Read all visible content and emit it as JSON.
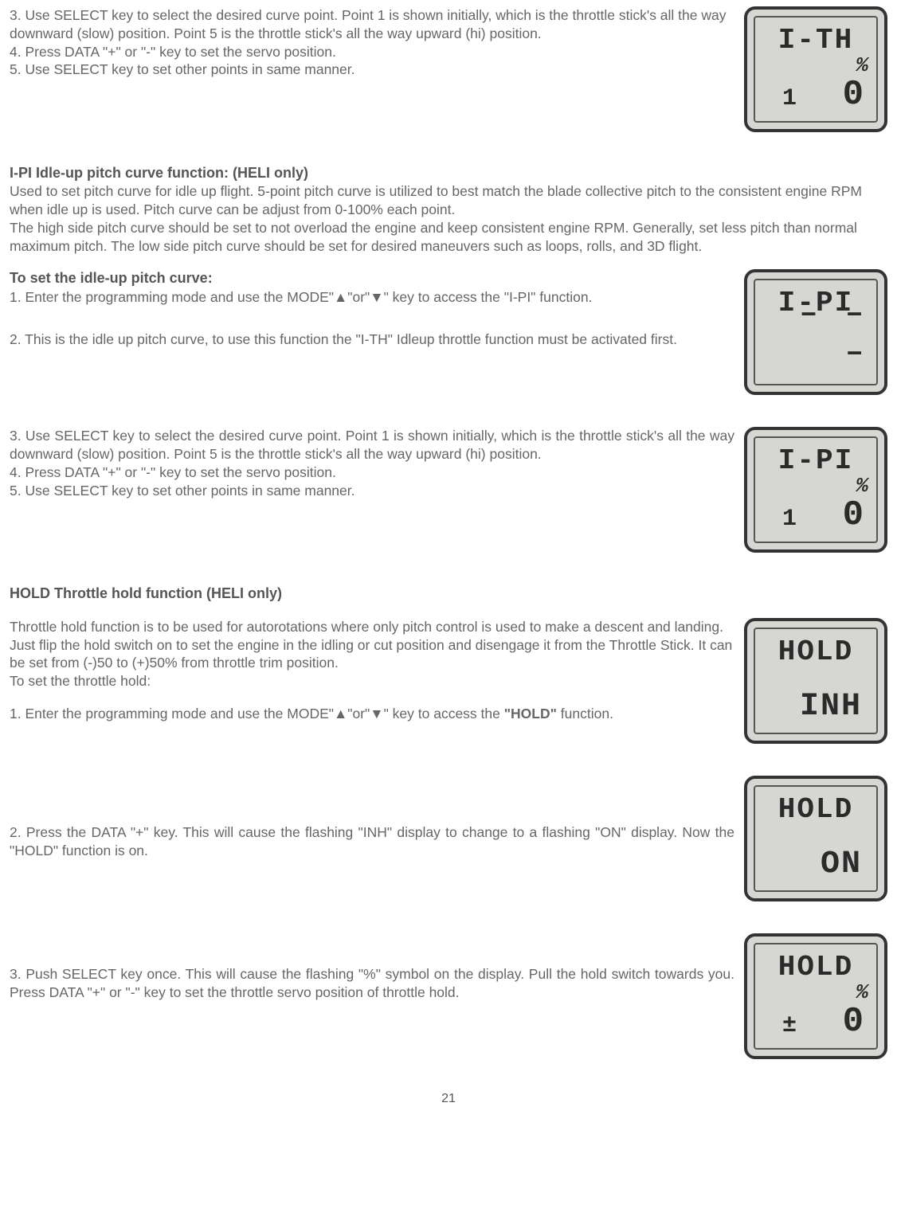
{
  "section_a": {
    "p3": "3. Use SELECT key to select the desired curve point. Point 1 is shown initially, which is the throttle stick's all the way downward (slow) position. Point 5 is the throttle stick's all the way upward (hi) position.",
    "p4": "4. Press DATA \"+\" or \"-\" key to set the servo position.",
    "p5": "5. Use SELECT key to set other points in same manner."
  },
  "lcd1": {
    "top": "I-TH",
    "pct": "%",
    "bl": "1",
    "br": "0"
  },
  "ipi": {
    "heading": "I-PI   Idle-up pitch curve function: (HELI only)",
    "intro1": "Used to set pitch curve for idle up flight. 5-point pitch curve is utilized to best match the blade collective pitch to the consistent engine RPM when idle up is used. Pitch curve can be adjust from 0-100% each point.",
    "intro2": "The high side pitch curve should be set to not overload the engine and keep consistent engine RPM. Generally, set less pitch than normal maximum pitch. The low side pitch curve should be set for desired maneuvers such as loops, rolls, and 3D flight.",
    "subhead": "To set the idle-up pitch curve:",
    "p1a": "1. Enter the programming mode and use the MODE\"▲\"or\"▼\" key to access the ",
    "p1b": "\"I-PI\"",
    "p1c": " function.",
    "p2a": "2. This is the idle up pitch curve, to use this function the ",
    "p2b": "\"I-TH\"",
    "p2c": " Idleup throttle function must be activated first.",
    "p3": "3. Use SELECT key to select the desired curve point. Point 1 is shown initially, which is the throttle stick's all the way downward (slow) position. Point 5 is the throttle stick's all the way upward (hi) position.",
    "p4": "4. Press DATA \"+\" or \"-\" key to set the servo position.",
    "p5": "5. Use SELECT key to set other points in same manner."
  },
  "lcd2": {
    "top": "I-PI",
    "mid": "– – –"
  },
  "lcd3": {
    "top": "I-PI",
    "pct": "%",
    "bl": "1",
    "br": "0"
  },
  "hold": {
    "heading": "HOLD   Throttle hold function (HELI only)",
    "intro": "Throttle hold function is to be used for autorotations where only pitch control is used to make a descent and landing. Just flip the hold switch on to set the engine in the idling or cut position and disengage it from the Throttle Stick. It can be set from (-)50 to (+)50% from throttle trim position.",
    "sub": "To set the throttle hold:",
    "p1a": "1. Enter the programming mode and use the MODE\"▲\"or\"▼\" key to access the ",
    "p1b": "\"HOLD\"",
    "p1c": " function.",
    "p2a": "2. Press the DATA \"+\" key. This will cause the flashing ",
    "p2b": "\"INH\"",
    "p2c": " display to change to a flashing ",
    "p2d": "\"ON\"",
    "p2e": " display. Now the ",
    "p2f": "\"HOLD\"",
    "p2g": " function is on.",
    "p3": "3. Push SELECT key once. This will cause the flashing \"%\" symbol on the display. Pull the hold switch towards you. Press DATA \"+\" or \"-\" key to set the throttle servo position of throttle hold."
  },
  "lcd4": {
    "top": "HOLD",
    "br": "INH"
  },
  "lcd5": {
    "top": "HOLD",
    "br": "ON"
  },
  "lcd6": {
    "top": "HOLD",
    "pct": "%",
    "bl": "±",
    "br": "0"
  },
  "page": "21"
}
